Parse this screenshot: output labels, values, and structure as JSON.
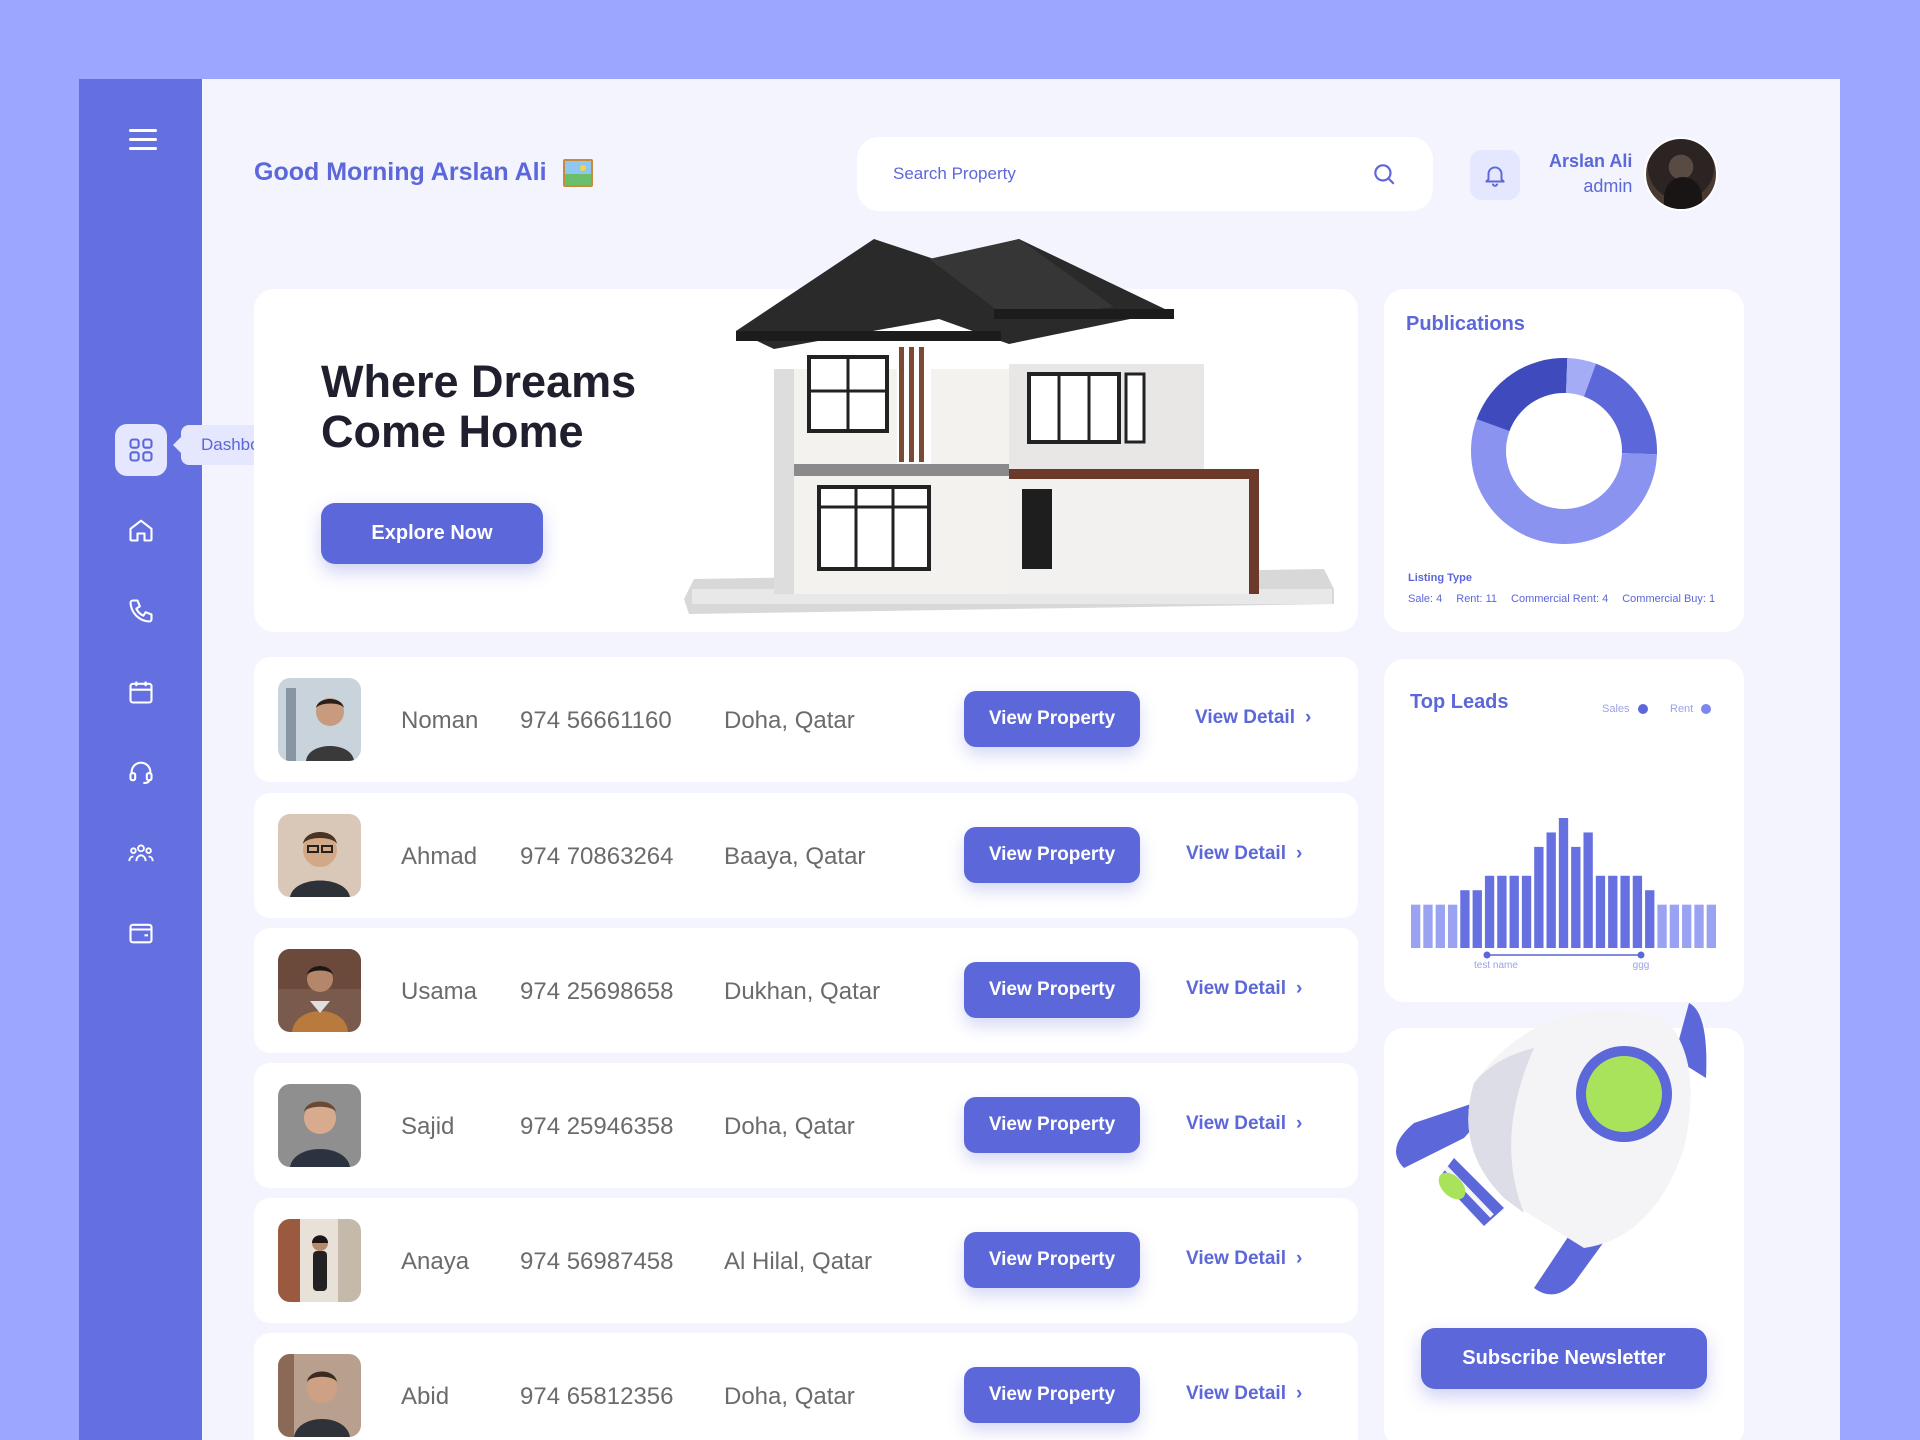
{
  "header": {
    "greeting": "Good Morning Arslan Ali",
    "search_placeholder": "Search Property",
    "user_name": "Arslan Ali",
    "user_role": "admin"
  },
  "sidebar": {
    "tooltip": "Dashboard",
    "items": [
      {
        "icon": "grid-icon",
        "active": true
      },
      {
        "icon": "home-icon"
      },
      {
        "icon": "phone-icon"
      },
      {
        "icon": "calendar-icon"
      },
      {
        "icon": "headset-icon"
      },
      {
        "icon": "users-icon"
      },
      {
        "icon": "wallet-icon"
      }
    ]
  },
  "hero": {
    "title": "Where Dreams Come Home",
    "button": "Explore Now"
  },
  "leads": [
    {
      "name": "Noman",
      "phone": "974 56661160",
      "location": "Doha, Qatar",
      "view_property": "View Property",
      "view_detail": "View Detail"
    },
    {
      "name": "Ahmad",
      "phone": "974 70863264",
      "location": "Baaya, Qatar",
      "view_property": "View Property",
      "view_detail": "View Detail"
    },
    {
      "name": "Usama",
      "phone": "974 25698658",
      "location": "Dukhan, Qatar",
      "view_property": "View Property",
      "view_detail": "View Detail"
    },
    {
      "name": "Sajid",
      "phone": "974 25946358",
      "location": "Doha, Qatar",
      "view_property": "View Property",
      "view_detail": "View Detail"
    },
    {
      "name": "Anaya",
      "phone": "974 56987458",
      "location": "Al Hilal, Qatar",
      "view_property": "View Property",
      "view_detail": "View Detail"
    },
    {
      "name": "Abid",
      "phone": "974 65812356",
      "location": "Doha, Qatar",
      "view_property": "View Property",
      "view_detail": "View Detail"
    }
  ],
  "publications": {
    "title": "Publications",
    "legend_title": "Listing Type",
    "legend": [
      "Sale: 4",
      "Rent: 11",
      "Commercial Rent: 4",
      "Commercial Buy: 1"
    ]
  },
  "top_leads": {
    "title": "Top Leads",
    "legend_sales": "Sales",
    "legend_rent": "Rent",
    "axis_left": "test name",
    "axis_right": "ggg"
  },
  "newsletter": {
    "button": "Subscribe Newsletter"
  },
  "colors": {
    "accent": "#5c67d9",
    "sidebar": "#6470e0",
    "background": "#9ca6ff"
  },
  "chart_data": [
    {
      "type": "pie",
      "title": "Publications",
      "categories": [
        "Sale",
        "Rent",
        "Commercial Rent",
        "Commercial Buy"
      ],
      "values": [
        4,
        11,
        4,
        1
      ]
    },
    {
      "type": "bar",
      "title": "Top Leads",
      "x_labels": [
        "test name",
        "ggg"
      ],
      "values": [
        3,
        3,
        3,
        3,
        4,
        4,
        5,
        5,
        5,
        5,
        7,
        8,
        9,
        7,
        8,
        5,
        5,
        5,
        5,
        4,
        3,
        3,
        3,
        3,
        3
      ]
    }
  ]
}
